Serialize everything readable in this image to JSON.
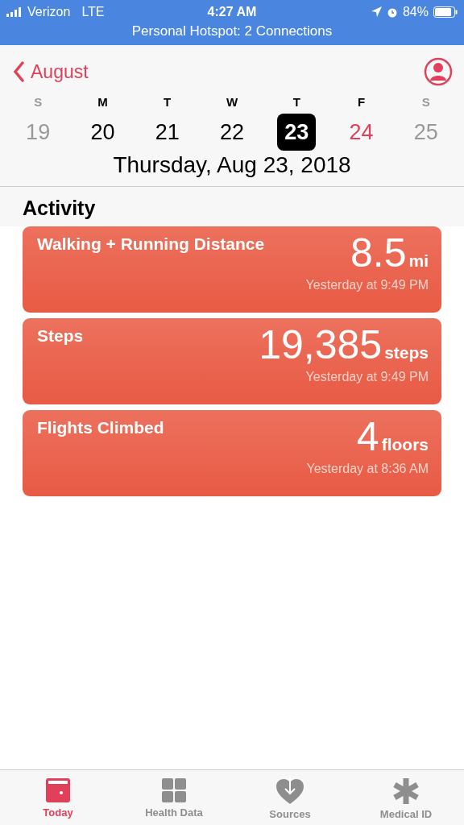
{
  "status_bar": {
    "carrier": "Verizon",
    "network": "LTE",
    "time": "4:27 AM",
    "battery": "84%",
    "hotspot": "Personal Hotspot: 2 Connections"
  },
  "nav": {
    "back": "August"
  },
  "week": [
    {
      "letter": "S",
      "day": "19",
      "kind": "weekend",
      "selected": false
    },
    {
      "letter": "M",
      "day": "20",
      "kind": "weekday",
      "selected": false
    },
    {
      "letter": "T",
      "day": "21",
      "kind": "weekday",
      "selected": false
    },
    {
      "letter": "W",
      "day": "22",
      "kind": "weekday",
      "selected": false
    },
    {
      "letter": "T",
      "day": "23",
      "kind": "weekday",
      "selected": true
    },
    {
      "letter": "F",
      "day": "24",
      "kind": "today",
      "selected": false
    },
    {
      "letter": "S",
      "day": "25",
      "kind": "weekend",
      "selected": false
    }
  ],
  "date_title": "Thursday, Aug 23, 2018",
  "section": "Activity",
  "cards": [
    {
      "title": "Walking + Running Distance",
      "value": "8.5",
      "unit": "mi",
      "time": "Yesterday at 9:49 PM"
    },
    {
      "title": "Steps",
      "value": "19,385",
      "unit": "steps",
      "time": "Yesterday at 9:49 PM"
    },
    {
      "title": "Flights Climbed",
      "value": "4",
      "unit": "floors",
      "time": "Yesterday at 8:36 AM"
    }
  ],
  "tabs": [
    {
      "label": "Today",
      "kind": "today",
      "selected": true
    },
    {
      "label": "Health Data",
      "kind": "grid",
      "selected": false
    },
    {
      "label": "Sources",
      "kind": "heart",
      "selected": false
    },
    {
      "label": "Medical ID",
      "kind": "asterisk",
      "selected": false
    }
  ]
}
